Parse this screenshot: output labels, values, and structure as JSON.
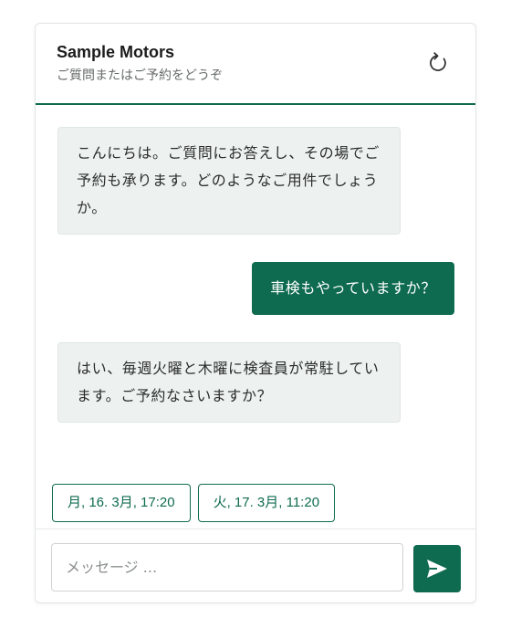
{
  "header": {
    "title": "Sample Motors",
    "subtitle": "ご質問またはご予約をどうぞ"
  },
  "icons": {
    "reset": "refresh-icon",
    "send": "send-icon"
  },
  "messages": [
    {
      "role": "bot",
      "text": "こんにちは。ご質問にお答えし、その場でご予約も承ります。どのようなご用件でしょうか。"
    },
    {
      "role": "user",
      "text": "車検もやっていますか？"
    },
    {
      "role": "bot",
      "text": "はい、毎週火曜と木曜に検査員が常駐しています。ご予約なさいますか？"
    }
  ],
  "suggestions": [
    {
      "label": "月, 16. 3月, 17:20"
    },
    {
      "label": "火, 17. 3月, 11:20"
    }
  ],
  "composer": {
    "placeholder": "メッセージ ...",
    "value": ""
  },
  "colors": {
    "accent": "#0f6b4f",
    "bot_bubble": "#edf2f0"
  }
}
